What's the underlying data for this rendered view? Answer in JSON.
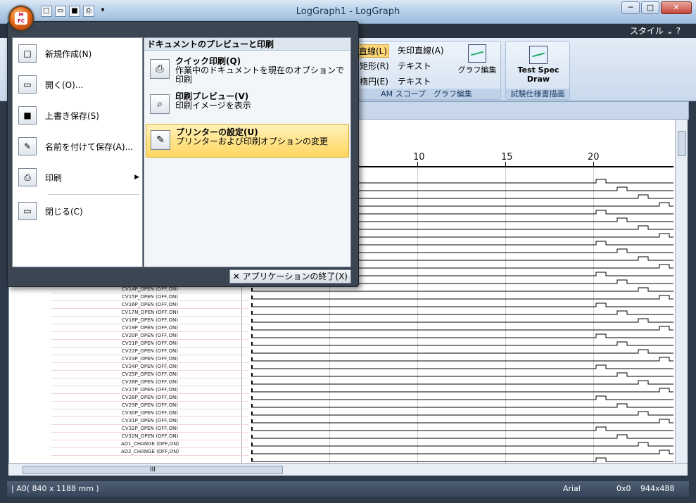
{
  "window": {
    "title": "LogGraph1 - LogGraph",
    "minimize": "─",
    "maximize": "□",
    "close": "✕"
  },
  "ribbon": {
    "style_menu": "スタイル ⌄ ?",
    "draw": {
      "line": "直線(L)",
      "arrow_line": "矢印直線(A)",
      "rect": "矩形(R)",
      "text1": "テキスト",
      "ellipse": "楕円(E)",
      "text2": "テキスト"
    },
    "graph_edit": "グラフ編集",
    "group_caption_1": "AM スコープ",
    "group_caption_2": "グラフ編集",
    "test_spec": "Test Spec Draw",
    "group_caption_3": "試験仕様書描画"
  },
  "app_menu": {
    "left_items": [
      {
        "label": "新規作成(N)",
        "icon": "new-doc-icon"
      },
      {
        "label": "開く(O)...",
        "icon": "open-folder-icon"
      },
      {
        "label": "上書き保存(S)",
        "icon": "save-icon"
      },
      {
        "label": "名前を付けて保存(A)...",
        "icon": "save-as-icon"
      },
      {
        "label": "印刷",
        "icon": "printer-icon"
      },
      {
        "label": "閉じる(C)",
        "icon": "close-folder-icon"
      }
    ],
    "right_header": "ドキュメントのプレビューと印刷",
    "right_items": [
      {
        "title": "クイック印刷(Q)",
        "desc": "作業中のドキュメントを現在のオプションで印刷",
        "icon": "quick-print-icon"
      },
      {
        "title": "印刷プレビュー(V)",
        "desc": "印刷イメージを表示",
        "icon": "print-preview-icon"
      },
      {
        "title": "プリンターの設定(U)",
        "desc": "プリンターおよび印刷オプションの変更",
        "icon": "printer-settings-icon",
        "selected": true
      }
    ],
    "exit": "アプリケーションの終了(X)"
  },
  "document": {
    "ruler": [
      "10",
      "15",
      "20"
    ],
    "signals": [
      "CV14P_OPEN (OFF,ON)",
      "CV15P_OPEN (OFF,ON)",
      "CV16P_OPEN (OFF,ON)",
      "CV17N_OPEN (OFF,ON)",
      "CV18P_OPEN (OFF,ON)",
      "CV19P_OPEN (OFF,ON)",
      "CV20P_OPEN (OFF,ON)",
      "CV21P_OPEN (OFF,ON)",
      "CV22P_OPEN (OFF,ON)",
      "CV23P_OPEN (OFF,ON)",
      "CV24P_OPEN (OFF,ON)",
      "CV25P_OPEN (OFF,ON)",
      "CV26P_OPEN (OFF,ON)",
      "CV27P_OPEN (OFF,ON)",
      "CV28P_OPEN (OFF,ON)",
      "CV29P_OPEN (OFF,ON)",
      "CV30P_OPEN (OFF,ON)",
      "CV31P_OPEN (OFF,ON)",
      "CV32P_OPEN (OFF,ON)",
      "CV32N_OPEN (OFF,ON)",
      "AO1_CHANGE (OFF,ON)",
      "AO2_CHANGE (OFF,ON)"
    ]
  },
  "status": {
    "paper": "| A0( 840 x 1188 mm )",
    "font": "Arial",
    "pos": "0x0",
    "size": "944x488"
  },
  "scrollbar": {
    "grip": "III"
  }
}
